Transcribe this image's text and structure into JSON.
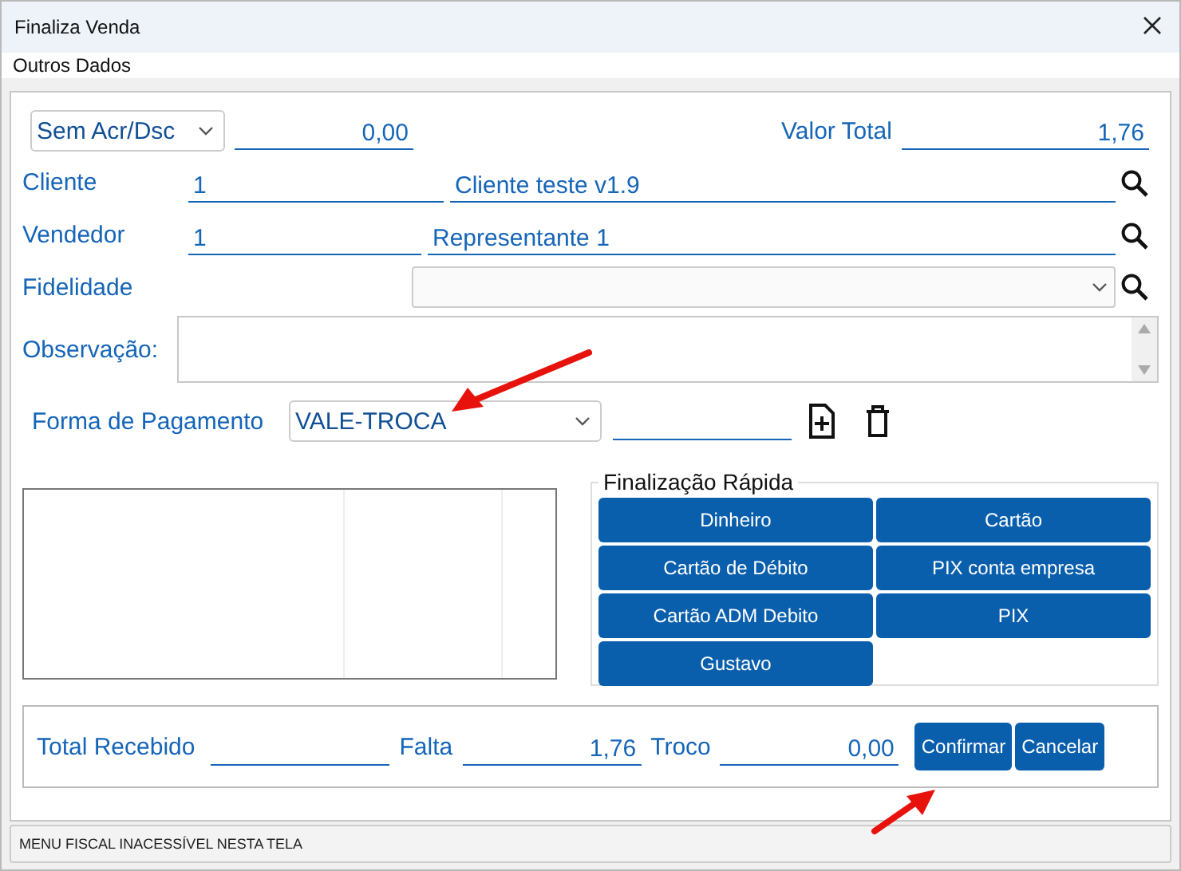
{
  "window": {
    "title": "Finaliza Venda"
  },
  "menu": [
    "Outros Dados"
  ],
  "adjustment": {
    "mode": "Sem Acr/Dsc",
    "value": "0,00"
  },
  "total": {
    "label": "Valor Total",
    "value": "1,76"
  },
  "lookups": [
    {
      "label": "Cliente",
      "code": "1",
      "name": "Cliente teste v1.9"
    },
    {
      "label": "Vendedor",
      "code": "1",
      "name": "Representante 1"
    }
  ],
  "loyalty": {
    "label": "Fidelidade"
  },
  "notes": {
    "label": "Observação:"
  },
  "payment": {
    "label": "Forma de Pagamento",
    "method": "VALE-TROCA"
  },
  "quick": {
    "title": "Finalização Rápida",
    "buttons": [
      "Dinheiro",
      "Cartão",
      "Cartão de Débito",
      "PIX conta empresa",
      "Cartão ADM Debito",
      "PIX",
      "Gustavo"
    ]
  },
  "footer": {
    "fields": [
      {
        "label": "Total Recebido"
      },
      {
        "label": "Falta",
        "value": "1,76"
      },
      {
        "label": "Troco",
        "value": "0,00"
      }
    ],
    "buttons": [
      "Confirmar",
      "Cancelar"
    ]
  },
  "status_bar": "MENU FISCAL INACESSÍVEL NESTA TELA"
}
